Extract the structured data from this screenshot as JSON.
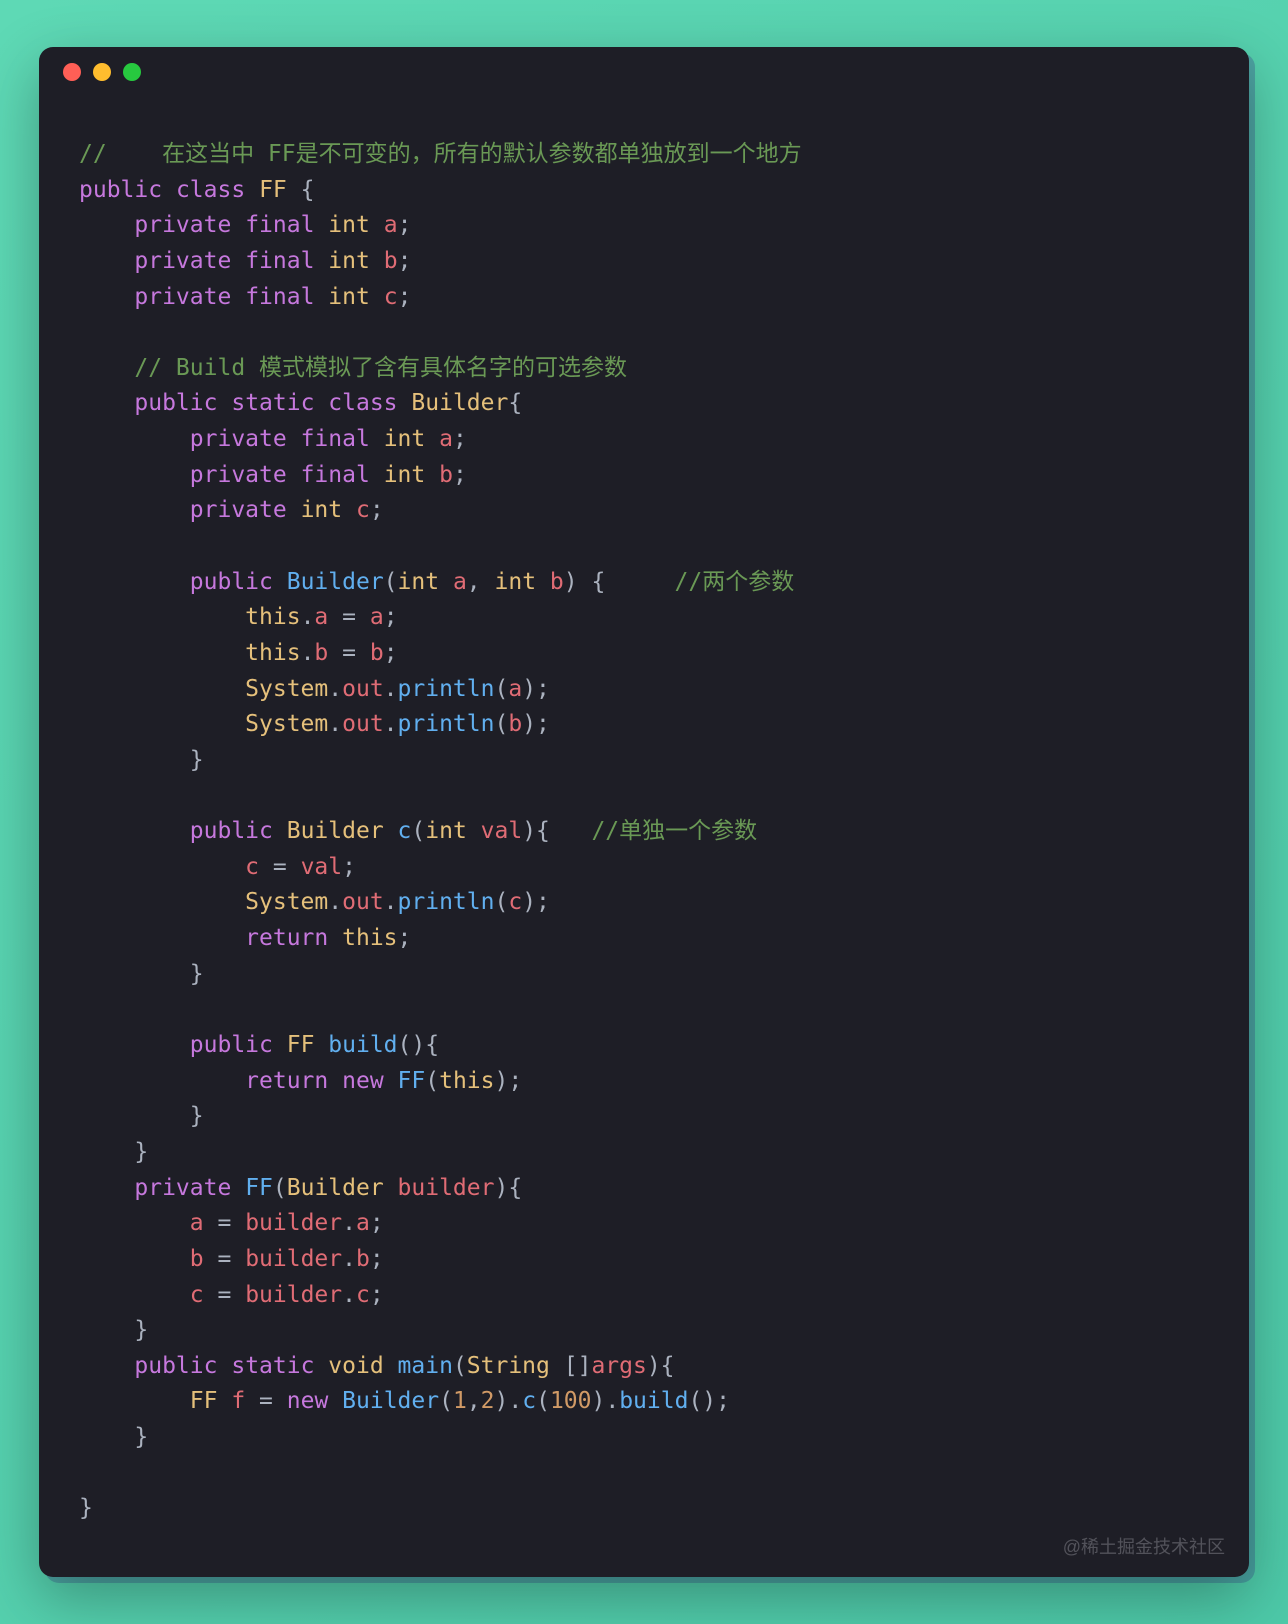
{
  "window": {
    "controls": [
      "close",
      "minimize",
      "maximize"
    ]
  },
  "code": {
    "tokens": [
      {
        "t": "//    在这当中 FF是不可变的，所有的默认参数都单独放到一个地方",
        "c": "comment"
      },
      {
        "t": "\n",
        "c": "nl"
      },
      {
        "t": "public",
        "c": "keyword"
      },
      {
        "t": " ",
        "c": "w"
      },
      {
        "t": "class",
        "c": "keyword"
      },
      {
        "t": " ",
        "c": "w"
      },
      {
        "t": "FF",
        "c": "class"
      },
      {
        "t": " {",
        "c": "punc"
      },
      {
        "t": "\n",
        "c": "nl"
      },
      {
        "t": "    ",
        "c": "w"
      },
      {
        "t": "private",
        "c": "keyword"
      },
      {
        "t": " ",
        "c": "w"
      },
      {
        "t": "final",
        "c": "keyword"
      },
      {
        "t": " ",
        "c": "w"
      },
      {
        "t": "int",
        "c": "type"
      },
      {
        "t": " ",
        "c": "w"
      },
      {
        "t": "a",
        "c": "var"
      },
      {
        "t": ";",
        "c": "punc"
      },
      {
        "t": "\n",
        "c": "nl"
      },
      {
        "t": "    ",
        "c": "w"
      },
      {
        "t": "private",
        "c": "keyword"
      },
      {
        "t": " ",
        "c": "w"
      },
      {
        "t": "final",
        "c": "keyword"
      },
      {
        "t": " ",
        "c": "w"
      },
      {
        "t": "int",
        "c": "type"
      },
      {
        "t": " ",
        "c": "w"
      },
      {
        "t": "b",
        "c": "var"
      },
      {
        "t": ";",
        "c": "punc"
      },
      {
        "t": "\n",
        "c": "nl"
      },
      {
        "t": "    ",
        "c": "w"
      },
      {
        "t": "private",
        "c": "keyword"
      },
      {
        "t": " ",
        "c": "w"
      },
      {
        "t": "final",
        "c": "keyword"
      },
      {
        "t": " ",
        "c": "w"
      },
      {
        "t": "int",
        "c": "type"
      },
      {
        "t": " ",
        "c": "w"
      },
      {
        "t": "c",
        "c": "var"
      },
      {
        "t": ";",
        "c": "punc"
      },
      {
        "t": "\n",
        "c": "nl"
      },
      {
        "t": "\n",
        "c": "nl"
      },
      {
        "t": "    ",
        "c": "w"
      },
      {
        "t": "// Build 模式模拟了含有具体名字的可选参数",
        "c": "comment"
      },
      {
        "t": "\n",
        "c": "nl"
      },
      {
        "t": "    ",
        "c": "w"
      },
      {
        "t": "public",
        "c": "keyword"
      },
      {
        "t": " ",
        "c": "w"
      },
      {
        "t": "static",
        "c": "keyword"
      },
      {
        "t": " ",
        "c": "w"
      },
      {
        "t": "class",
        "c": "keyword"
      },
      {
        "t": " ",
        "c": "w"
      },
      {
        "t": "Builder",
        "c": "class"
      },
      {
        "t": "{",
        "c": "punc"
      },
      {
        "t": "\n",
        "c": "nl"
      },
      {
        "t": "        ",
        "c": "w"
      },
      {
        "t": "private",
        "c": "keyword"
      },
      {
        "t": " ",
        "c": "w"
      },
      {
        "t": "final",
        "c": "keyword"
      },
      {
        "t": " ",
        "c": "w"
      },
      {
        "t": "int",
        "c": "type"
      },
      {
        "t": " ",
        "c": "w"
      },
      {
        "t": "a",
        "c": "var"
      },
      {
        "t": ";",
        "c": "punc"
      },
      {
        "t": "\n",
        "c": "nl"
      },
      {
        "t": "        ",
        "c": "w"
      },
      {
        "t": "private",
        "c": "keyword"
      },
      {
        "t": " ",
        "c": "w"
      },
      {
        "t": "final",
        "c": "keyword"
      },
      {
        "t": " ",
        "c": "w"
      },
      {
        "t": "int",
        "c": "type"
      },
      {
        "t": " ",
        "c": "w"
      },
      {
        "t": "b",
        "c": "var"
      },
      {
        "t": ";",
        "c": "punc"
      },
      {
        "t": "\n",
        "c": "nl"
      },
      {
        "t": "        ",
        "c": "w"
      },
      {
        "t": "private",
        "c": "keyword"
      },
      {
        "t": " ",
        "c": "w"
      },
      {
        "t": "int",
        "c": "type"
      },
      {
        "t": " ",
        "c": "w"
      },
      {
        "t": "c",
        "c": "var"
      },
      {
        "t": ";",
        "c": "punc"
      },
      {
        "t": "\n",
        "c": "nl"
      },
      {
        "t": "\n",
        "c": "nl"
      },
      {
        "t": "        ",
        "c": "w"
      },
      {
        "t": "public",
        "c": "keyword"
      },
      {
        "t": " ",
        "c": "w"
      },
      {
        "t": "Builder",
        "c": "method"
      },
      {
        "t": "(",
        "c": "punc"
      },
      {
        "t": "int",
        "c": "type"
      },
      {
        "t": " ",
        "c": "w"
      },
      {
        "t": "a",
        "c": "var"
      },
      {
        "t": ", ",
        "c": "punc"
      },
      {
        "t": "int",
        "c": "type"
      },
      {
        "t": " ",
        "c": "w"
      },
      {
        "t": "b",
        "c": "var"
      },
      {
        "t": ") {     ",
        "c": "punc"
      },
      {
        "t": "//两个参数",
        "c": "comment"
      },
      {
        "t": "\n",
        "c": "nl"
      },
      {
        "t": "            ",
        "c": "w"
      },
      {
        "t": "this",
        "c": "this"
      },
      {
        "t": ".",
        "c": "punc"
      },
      {
        "t": "a",
        "c": "var"
      },
      {
        "t": " = ",
        "c": "punc"
      },
      {
        "t": "a",
        "c": "var"
      },
      {
        "t": ";",
        "c": "punc"
      },
      {
        "t": "\n",
        "c": "nl"
      },
      {
        "t": "            ",
        "c": "w"
      },
      {
        "t": "this",
        "c": "this"
      },
      {
        "t": ".",
        "c": "punc"
      },
      {
        "t": "b",
        "c": "var"
      },
      {
        "t": " = ",
        "c": "punc"
      },
      {
        "t": "b",
        "c": "var"
      },
      {
        "t": ";",
        "c": "punc"
      },
      {
        "t": "\n",
        "c": "nl"
      },
      {
        "t": "            ",
        "c": "w"
      },
      {
        "t": "System",
        "c": "class"
      },
      {
        "t": ".",
        "c": "punc"
      },
      {
        "t": "out",
        "c": "var"
      },
      {
        "t": ".",
        "c": "punc"
      },
      {
        "t": "println",
        "c": "method"
      },
      {
        "t": "(",
        "c": "punc"
      },
      {
        "t": "a",
        "c": "var"
      },
      {
        "t": ");",
        "c": "punc"
      },
      {
        "t": "\n",
        "c": "nl"
      },
      {
        "t": "            ",
        "c": "w"
      },
      {
        "t": "System",
        "c": "class"
      },
      {
        "t": ".",
        "c": "punc"
      },
      {
        "t": "out",
        "c": "var"
      },
      {
        "t": ".",
        "c": "punc"
      },
      {
        "t": "println",
        "c": "method"
      },
      {
        "t": "(",
        "c": "punc"
      },
      {
        "t": "b",
        "c": "var"
      },
      {
        "t": ");",
        "c": "punc"
      },
      {
        "t": "\n",
        "c": "nl"
      },
      {
        "t": "        }",
        "c": "punc"
      },
      {
        "t": "\n",
        "c": "nl"
      },
      {
        "t": "\n",
        "c": "nl"
      },
      {
        "t": "        ",
        "c": "w"
      },
      {
        "t": "public",
        "c": "keyword"
      },
      {
        "t": " ",
        "c": "w"
      },
      {
        "t": "Builder",
        "c": "class"
      },
      {
        "t": " ",
        "c": "w"
      },
      {
        "t": "c",
        "c": "method"
      },
      {
        "t": "(",
        "c": "punc"
      },
      {
        "t": "int",
        "c": "type"
      },
      {
        "t": " ",
        "c": "w"
      },
      {
        "t": "val",
        "c": "var"
      },
      {
        "t": "){   ",
        "c": "punc"
      },
      {
        "t": "//单独一个参数",
        "c": "comment"
      },
      {
        "t": "\n",
        "c": "nl"
      },
      {
        "t": "            ",
        "c": "w"
      },
      {
        "t": "c",
        "c": "var"
      },
      {
        "t": " = ",
        "c": "punc"
      },
      {
        "t": "val",
        "c": "var"
      },
      {
        "t": ";",
        "c": "punc"
      },
      {
        "t": "\n",
        "c": "nl"
      },
      {
        "t": "            ",
        "c": "w"
      },
      {
        "t": "System",
        "c": "class"
      },
      {
        "t": ".",
        "c": "punc"
      },
      {
        "t": "out",
        "c": "var"
      },
      {
        "t": ".",
        "c": "punc"
      },
      {
        "t": "println",
        "c": "method"
      },
      {
        "t": "(",
        "c": "punc"
      },
      {
        "t": "c",
        "c": "var"
      },
      {
        "t": ");",
        "c": "punc"
      },
      {
        "t": "\n",
        "c": "nl"
      },
      {
        "t": "            ",
        "c": "w"
      },
      {
        "t": "return",
        "c": "keyword"
      },
      {
        "t": " ",
        "c": "w"
      },
      {
        "t": "this",
        "c": "this"
      },
      {
        "t": ";",
        "c": "punc"
      },
      {
        "t": "\n",
        "c": "nl"
      },
      {
        "t": "        }",
        "c": "punc"
      },
      {
        "t": "\n",
        "c": "nl"
      },
      {
        "t": "\n",
        "c": "nl"
      },
      {
        "t": "        ",
        "c": "w"
      },
      {
        "t": "public",
        "c": "keyword"
      },
      {
        "t": " ",
        "c": "w"
      },
      {
        "t": "FF",
        "c": "class"
      },
      {
        "t": " ",
        "c": "w"
      },
      {
        "t": "build",
        "c": "method"
      },
      {
        "t": "(){",
        "c": "punc"
      },
      {
        "t": "\n",
        "c": "nl"
      },
      {
        "t": "            ",
        "c": "w"
      },
      {
        "t": "return",
        "c": "keyword"
      },
      {
        "t": " ",
        "c": "w"
      },
      {
        "t": "new",
        "c": "keyword"
      },
      {
        "t": " ",
        "c": "w"
      },
      {
        "t": "FF",
        "c": "method"
      },
      {
        "t": "(",
        "c": "punc"
      },
      {
        "t": "this",
        "c": "this"
      },
      {
        "t": ");",
        "c": "punc"
      },
      {
        "t": "\n",
        "c": "nl"
      },
      {
        "t": "        }",
        "c": "punc"
      },
      {
        "t": "\n",
        "c": "nl"
      },
      {
        "t": "    }",
        "c": "punc"
      },
      {
        "t": "\n",
        "c": "nl"
      },
      {
        "t": "    ",
        "c": "w"
      },
      {
        "t": "private",
        "c": "keyword"
      },
      {
        "t": " ",
        "c": "w"
      },
      {
        "t": "FF",
        "c": "method"
      },
      {
        "t": "(",
        "c": "punc"
      },
      {
        "t": "Builder",
        "c": "class"
      },
      {
        "t": " ",
        "c": "w"
      },
      {
        "t": "builder",
        "c": "var"
      },
      {
        "t": "){",
        "c": "punc"
      },
      {
        "t": "\n",
        "c": "nl"
      },
      {
        "t": "        ",
        "c": "w"
      },
      {
        "t": "a",
        "c": "var"
      },
      {
        "t": " = ",
        "c": "punc"
      },
      {
        "t": "builder",
        "c": "var"
      },
      {
        "t": ".",
        "c": "punc"
      },
      {
        "t": "a",
        "c": "var"
      },
      {
        "t": ";",
        "c": "punc"
      },
      {
        "t": "\n",
        "c": "nl"
      },
      {
        "t": "        ",
        "c": "w"
      },
      {
        "t": "b",
        "c": "var"
      },
      {
        "t": " = ",
        "c": "punc"
      },
      {
        "t": "builder",
        "c": "var"
      },
      {
        "t": ".",
        "c": "punc"
      },
      {
        "t": "b",
        "c": "var"
      },
      {
        "t": ";",
        "c": "punc"
      },
      {
        "t": "\n",
        "c": "nl"
      },
      {
        "t": "        ",
        "c": "w"
      },
      {
        "t": "c",
        "c": "var"
      },
      {
        "t": " = ",
        "c": "punc"
      },
      {
        "t": "builder",
        "c": "var"
      },
      {
        "t": ".",
        "c": "punc"
      },
      {
        "t": "c",
        "c": "var"
      },
      {
        "t": ";",
        "c": "punc"
      },
      {
        "t": "\n",
        "c": "nl"
      },
      {
        "t": "    }",
        "c": "punc"
      },
      {
        "t": "\n",
        "c": "nl"
      },
      {
        "t": "    ",
        "c": "w"
      },
      {
        "t": "public",
        "c": "keyword"
      },
      {
        "t": " ",
        "c": "w"
      },
      {
        "t": "static",
        "c": "keyword"
      },
      {
        "t": " ",
        "c": "w"
      },
      {
        "t": "void",
        "c": "type"
      },
      {
        "t": " ",
        "c": "w"
      },
      {
        "t": "main",
        "c": "method"
      },
      {
        "t": "(",
        "c": "punc"
      },
      {
        "t": "String",
        "c": "class"
      },
      {
        "t": " []",
        "c": "punc"
      },
      {
        "t": "args",
        "c": "var"
      },
      {
        "t": "){",
        "c": "punc"
      },
      {
        "t": "\n",
        "c": "nl"
      },
      {
        "t": "        ",
        "c": "w"
      },
      {
        "t": "FF",
        "c": "class"
      },
      {
        "t": " ",
        "c": "w"
      },
      {
        "t": "f",
        "c": "var"
      },
      {
        "t": " = ",
        "c": "punc"
      },
      {
        "t": "new",
        "c": "keyword"
      },
      {
        "t": " ",
        "c": "w"
      },
      {
        "t": "Builder",
        "c": "method"
      },
      {
        "t": "(",
        "c": "punc"
      },
      {
        "t": "1",
        "c": "number"
      },
      {
        "t": ",",
        "c": "punc"
      },
      {
        "t": "2",
        "c": "number"
      },
      {
        "t": ").",
        "c": "punc"
      },
      {
        "t": "c",
        "c": "method"
      },
      {
        "t": "(",
        "c": "punc"
      },
      {
        "t": "100",
        "c": "number"
      },
      {
        "t": ").",
        "c": "punc"
      },
      {
        "t": "build",
        "c": "method"
      },
      {
        "t": "();",
        "c": "punc"
      },
      {
        "t": "\n",
        "c": "nl"
      },
      {
        "t": "    }",
        "c": "punc"
      },
      {
        "t": "\n",
        "c": "nl"
      },
      {
        "t": "\n",
        "c": "nl"
      },
      {
        "t": "}",
        "c": "punc"
      }
    ]
  },
  "watermark": "@稀土掘金技术社区"
}
